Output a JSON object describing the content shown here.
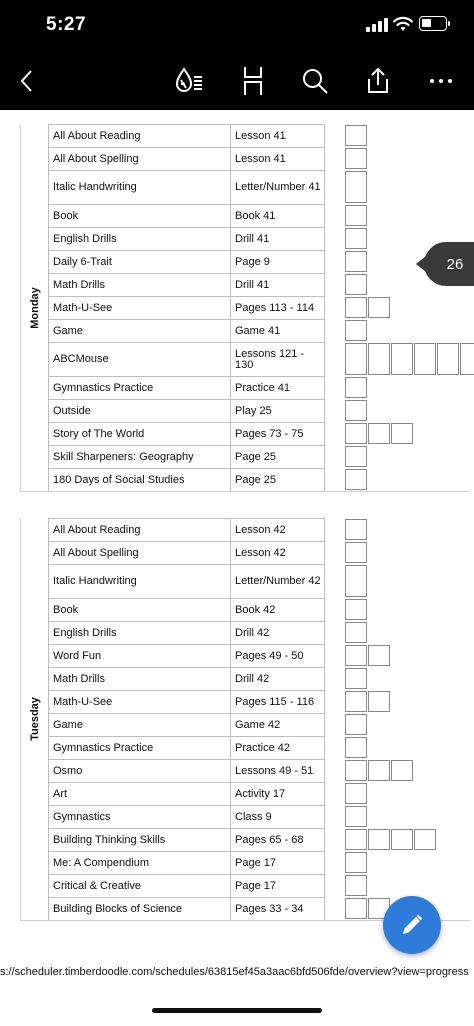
{
  "status_bar": {
    "time": "5:27"
  },
  "toolbar": {
    "icons": [
      "back-arrow-icon",
      "reader-mode-icon",
      "crop-icon",
      "search-icon",
      "share-icon",
      "more-icon"
    ]
  },
  "page_indicator": {
    "number": "26"
  },
  "schedule": {
    "days": [
      {
        "label": "Monday",
        "rows": [
          {
            "subject": "All About Reading",
            "lesson": "Lesson 41",
            "boxes": 1
          },
          {
            "subject": "All About Spelling",
            "lesson": "Lesson 41",
            "boxes": 1
          },
          {
            "subject": "Italic Handwriting",
            "lesson": "Letter/Number 41",
            "boxes": 1
          },
          {
            "subject": "Book",
            "lesson": "Book 41",
            "boxes": 1
          },
          {
            "subject": "English Drills",
            "lesson": "Drill 41",
            "boxes": 1
          },
          {
            "subject": "Daily 6-Trait",
            "lesson": "Page 9",
            "boxes": 1
          },
          {
            "subject": "Math Drills",
            "lesson": "Drill 41",
            "boxes": 1
          },
          {
            "subject": "Math-U-See",
            "lesson": "Pages 113 - 114",
            "boxes": 2
          },
          {
            "subject": "Game",
            "lesson": "Game 41",
            "boxes": 1
          },
          {
            "subject": "ABCMouse",
            "lesson": "Lessons 121 - 130",
            "boxes": 6
          },
          {
            "subject": "Gymnastics Practice",
            "lesson": "Practice 41",
            "boxes": 1
          },
          {
            "subject": "Outside",
            "lesson": "Play 25",
            "boxes": 1
          },
          {
            "subject": "Story of The World",
            "lesson": "Pages 73 - 75",
            "boxes": 3
          },
          {
            "subject": "Skill Sharpeners: Geography",
            "lesson": "Page 25",
            "boxes": 1
          },
          {
            "subject": "180 Days of Social Studies",
            "lesson": "Page 25",
            "boxes": 1
          }
        ]
      },
      {
        "label": "Tuesday",
        "rows": [
          {
            "subject": "All About Reading",
            "lesson": "Lesson 42",
            "boxes": 1
          },
          {
            "subject": "All About Spelling",
            "lesson": "Lesson 42",
            "boxes": 1
          },
          {
            "subject": "Italic Handwriting",
            "lesson": "Letter/Number 42",
            "boxes": 1
          },
          {
            "subject": "Book",
            "lesson": "Book 42",
            "boxes": 1
          },
          {
            "subject": "English Drills",
            "lesson": "Drill 42",
            "boxes": 1
          },
          {
            "subject": "Word Fun",
            "lesson": "Pages 49 - 50",
            "boxes": 2
          },
          {
            "subject": "Math Drills",
            "lesson": "Drill 42",
            "boxes": 1
          },
          {
            "subject": "Math-U-See",
            "lesson": "Pages 115 - 116",
            "boxes": 2
          },
          {
            "subject": "Game",
            "lesson": "Game 42",
            "boxes": 1
          },
          {
            "subject": "Gymnastics Practice",
            "lesson": "Practice 42",
            "boxes": 1
          },
          {
            "subject": "Osmo",
            "lesson": "Lessons 49 - 51",
            "boxes": 3
          },
          {
            "subject": "Art",
            "lesson": "Activity 17",
            "boxes": 1
          },
          {
            "subject": "Gymnastics",
            "lesson": "Class 9",
            "boxes": 1
          },
          {
            "subject": "Building Thinking Skills",
            "lesson": "Pages 65 - 68",
            "boxes": 4
          },
          {
            "subject": "Me: A Compendium",
            "lesson": "Page 17",
            "boxes": 1
          },
          {
            "subject": "Critical & Creative",
            "lesson": "Page 17",
            "boxes": 1
          },
          {
            "subject": "Building Blocks of Science",
            "lesson": "Pages 33 - 34",
            "boxes": 2
          }
        ]
      }
    ]
  },
  "footer": {
    "url": "s://scheduler.timberdoodle.com/schedules/63815ef45a3aac6bfd506fde/overview?view=progress"
  },
  "colors": {
    "toolbar_bg": "#000000",
    "fab": "#2f7bd9",
    "page_badge": "#3a3a3a"
  }
}
